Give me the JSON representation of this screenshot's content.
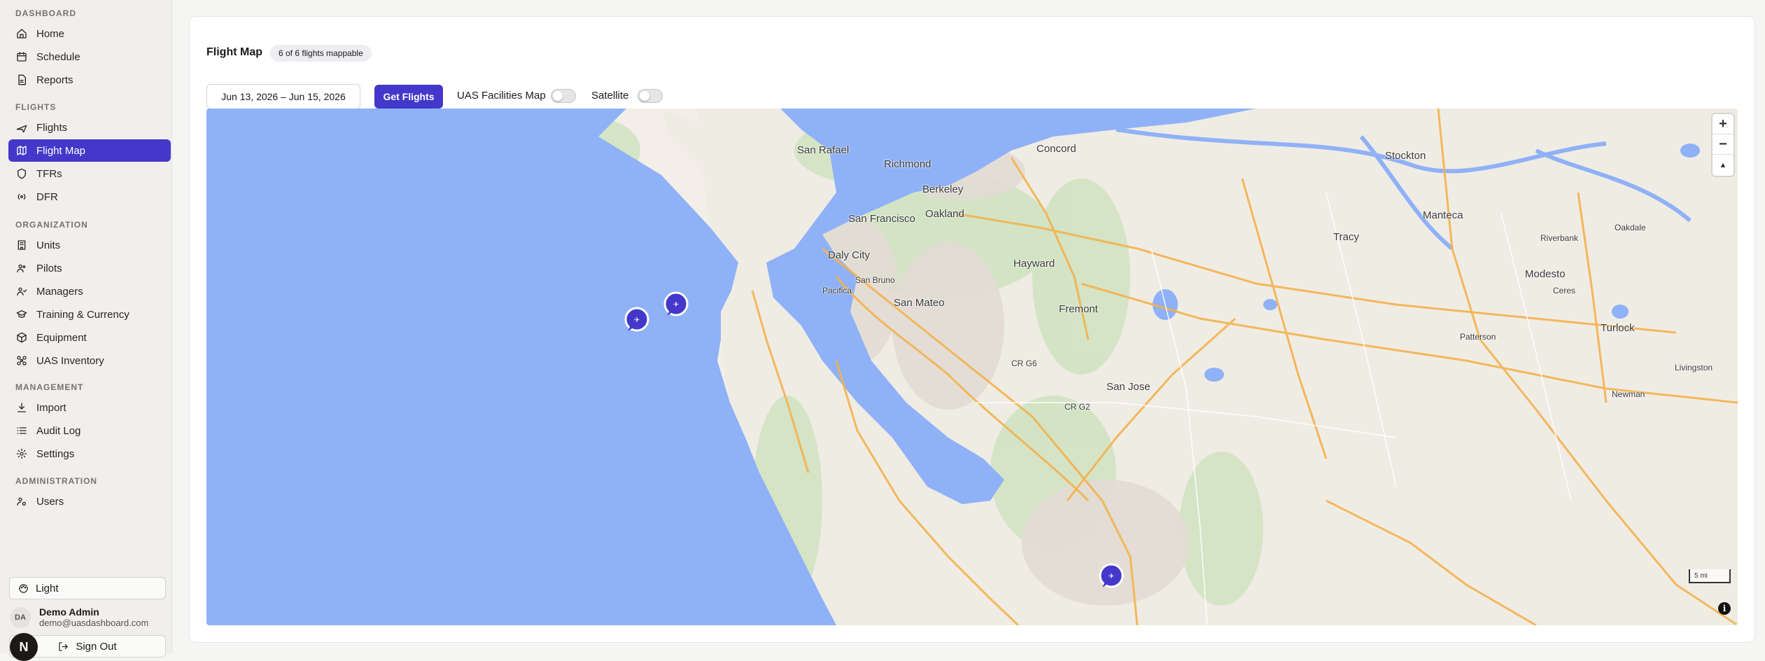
{
  "sidebar": {
    "sections": [
      {
        "title": "DASHBOARD",
        "items": [
          {
            "label": "Home",
            "icon": "home-icon"
          },
          {
            "label": "Schedule",
            "icon": "calendar-icon"
          },
          {
            "label": "Reports",
            "icon": "file-icon"
          }
        ]
      },
      {
        "title": "FLIGHTS",
        "items": [
          {
            "label": "Flights",
            "icon": "plane-icon"
          },
          {
            "label": "Flight Map",
            "icon": "map-icon",
            "active": true
          },
          {
            "label": "TFRs",
            "icon": "shield-icon"
          },
          {
            "label": "DFR",
            "icon": "radio-icon"
          }
        ]
      },
      {
        "title": "ORGANIZATION",
        "items": [
          {
            "label": "Units",
            "icon": "building-icon"
          },
          {
            "label": "Pilots",
            "icon": "users-icon"
          },
          {
            "label": "Managers",
            "icon": "user-check-icon"
          },
          {
            "label": "Training & Currency",
            "icon": "graduation-cap-icon"
          },
          {
            "label": "Equipment",
            "icon": "box-icon"
          },
          {
            "label": "UAS Inventory",
            "icon": "drone-icon"
          }
        ]
      },
      {
        "title": "MANAGEMENT",
        "items": [
          {
            "label": "Import",
            "icon": "download-icon"
          },
          {
            "label": "Audit Log",
            "icon": "list-icon"
          },
          {
            "label": "Settings",
            "icon": "gear-icon"
          }
        ]
      },
      {
        "title": "ADMINISTRATION",
        "items": [
          {
            "label": "Users",
            "icon": "user-cog-icon"
          }
        ]
      }
    ],
    "theme_label": "Light",
    "user": {
      "initials": "DA",
      "name": "Demo Admin",
      "email": "demo@uasdashboard.com"
    },
    "sign_out_label": "Sign Out",
    "logo_letter": "N"
  },
  "main": {
    "title": "Flight Map",
    "badge": "6 of 6 flights mappable",
    "date_range": "Jun 13, 2026 – Jun 15, 2026",
    "get_flights_label": "Get Flights",
    "uas_facilities_label": "UAS Facilities Map",
    "satellite_label": "Satellite"
  },
  "map": {
    "places": [
      {
        "name": "San Rafael",
        "size": "big"
      },
      {
        "name": "Richmond",
        "size": "big"
      },
      {
        "name": "Concord",
        "size": "big"
      },
      {
        "name": "Berkeley",
        "size": "big"
      },
      {
        "name": "Oakland",
        "size": "big"
      },
      {
        "name": "San Francisco",
        "size": "big"
      },
      {
        "name": "Daly City",
        "size": "big"
      },
      {
        "name": "San Bruno",
        "size": "sm"
      },
      {
        "name": "Pacifica",
        "size": "sm"
      },
      {
        "name": "San Mateo",
        "size": "big"
      },
      {
        "name": "Hayward",
        "size": "big"
      },
      {
        "name": "Fremont",
        "size": "big"
      },
      {
        "name": "San Jose",
        "size": "big"
      },
      {
        "name": "Stockton",
        "size": "big"
      },
      {
        "name": "Manteca",
        "size": "big"
      },
      {
        "name": "Tracy",
        "size": "big"
      },
      {
        "name": "Riverbank",
        "size": "sm"
      },
      {
        "name": "Oakdale",
        "size": "sm"
      },
      {
        "name": "Modesto",
        "size": "big"
      },
      {
        "name": "Ceres",
        "size": "sm"
      },
      {
        "name": "Patterson",
        "size": "sm"
      },
      {
        "name": "Turlock",
        "size": "big"
      },
      {
        "name": "Livingston",
        "size": "sm"
      },
      {
        "name": "Newman",
        "size": "sm"
      },
      {
        "name": "CR G6",
        "size": "sm"
      },
      {
        "name": "CR G2",
        "size": "sm"
      }
    ],
    "scale_label": "5 mi",
    "zoom_in": "+",
    "zoom_out": "−",
    "reset_north": "▲",
    "marker_color": "#4338ca",
    "water_color": "#8fb1f7"
  }
}
